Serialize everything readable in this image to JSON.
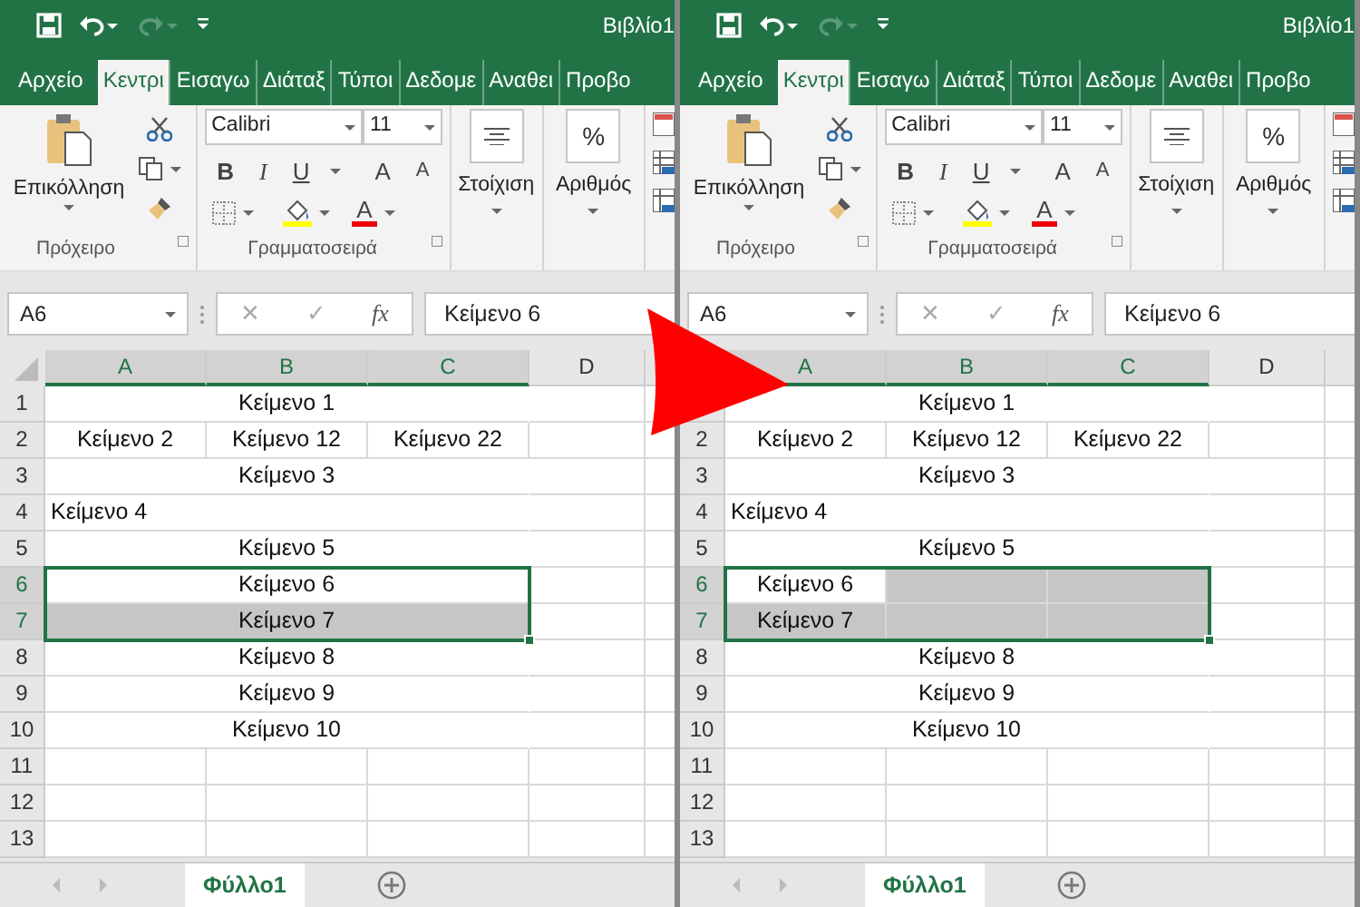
{
  "panes": [
    {
      "title": "Βιβλίο1",
      "select_all_corner": true,
      "tabs": [
        {
          "label": "Αρχείο",
          "selected": false
        },
        {
          "label": "Κεντρι",
          "selected": true
        },
        {
          "label": "Εισαγω",
          "selected": false
        },
        {
          "label": "Διάταξ",
          "selected": false
        },
        {
          "label": "Τύποι",
          "selected": false
        },
        {
          "label": "Δεδομε",
          "selected": false
        },
        {
          "label": "Αναθει",
          "selected": false
        },
        {
          "label": "Προβο",
          "selected": false
        }
      ],
      "ribbon": {
        "paste": "Επικόλληση",
        "clipboard_group": "Πρόχειρο",
        "font": "Calibri",
        "size": "11",
        "bold": "B",
        "italic": "I",
        "underline": "U",
        "grow": "A",
        "shrink": "A",
        "font_color": "A",
        "font_group": "Γραμματοσειρά",
        "alignment": "Στοίχιση",
        "number_symbol": "%",
        "number": "Αριθμός"
      },
      "formula_bar": {
        "name_box": "A6",
        "cancel": "✕",
        "enter": "✓",
        "function": "fx",
        "value": "Κείμενο 6"
      },
      "columns": [
        {
          "label": "A",
          "selected": true
        },
        {
          "label": "B",
          "selected": true
        },
        {
          "label": "C",
          "selected": true
        },
        {
          "label": "D",
          "selected": false
        }
      ],
      "rows": [
        {
          "num": "1",
          "selected": false,
          "kind": "merged",
          "cells": [
            {
              "text": "Κείμενο 1",
              "centered": true
            }
          ]
        },
        {
          "num": "2",
          "selected": false,
          "kind": "cells",
          "cells": [
            {
              "text": "Κείμενο 2",
              "centered": true
            },
            {
              "text": "Κείμενο 12",
              "centered": true
            },
            {
              "text": "Κείμενο 22",
              "centered": true
            }
          ]
        },
        {
          "num": "3",
          "selected": false,
          "kind": "merged",
          "cells": [
            {
              "text": "Κείμενο 3",
              "centered": true
            }
          ]
        },
        {
          "num": "4",
          "selected": false,
          "kind": "merged",
          "cells": [
            {
              "text": "Κείμενο 4",
              "centered": false
            }
          ]
        },
        {
          "num": "5",
          "selected": false,
          "kind": "merged",
          "cells": [
            {
              "text": "Κείμενο 5",
              "centered": true
            }
          ]
        },
        {
          "num": "6",
          "selected": true,
          "kind": "merged",
          "cells": [
            {
              "text": "Κείμενο 6",
              "centered": true,
              "selected": true,
              "active": true
            }
          ]
        },
        {
          "num": "7",
          "selected": true,
          "kind": "merged",
          "cells": [
            {
              "text": "Κείμενο 7",
              "centered": true,
              "selected": true,
              "active": false
            }
          ]
        },
        {
          "num": "8",
          "selected": false,
          "kind": "merged",
          "cells": [
            {
              "text": "Κείμενο 8",
              "centered": true
            }
          ]
        },
        {
          "num": "9",
          "selected": false,
          "kind": "merged",
          "cells": [
            {
              "text": "Κείμενο 9",
              "centered": true
            }
          ]
        },
        {
          "num": "10",
          "selected": false,
          "kind": "merged",
          "cells": [
            {
              "text": "Κείμενο 10",
              "centered": true
            }
          ]
        },
        {
          "num": "11",
          "selected": false,
          "kind": "cells",
          "cells": []
        },
        {
          "num": "12",
          "selected": false,
          "kind": "cells",
          "cells": []
        },
        {
          "num": "13",
          "selected": false,
          "kind": "cells",
          "cells": []
        }
      ],
      "sheets": [
        {
          "label": "Φύλλο1",
          "selected": true
        }
      ]
    },
    {
      "title": "Βιβλίο1",
      "tabs": [
        {
          "label": "Αρχείο",
          "selected": false
        },
        {
          "label": "Κεντρι",
          "selected": true
        },
        {
          "label": "Εισαγω",
          "selected": false
        },
        {
          "label": "Διάταξ",
          "selected": false
        },
        {
          "label": "Τύποι",
          "selected": false
        },
        {
          "label": "Δεδομε",
          "selected": false
        },
        {
          "label": "Αναθει",
          "selected": false
        },
        {
          "label": "Προβο",
          "selected": false
        }
      ],
      "ribbon": {
        "paste": "Επικόλληση",
        "clipboard_group": "Πρόχειρο",
        "font": "Calibri",
        "size": "11",
        "bold": "B",
        "italic": "I",
        "underline": "U",
        "grow": "A",
        "shrink": "A",
        "font_color": "A",
        "font_group": "Γραμματοσειρά",
        "alignment": "Στοίχιση",
        "number_symbol": "%",
        "number": "Αριθμός"
      },
      "formula_bar": {
        "name_box": "A6",
        "cancel": "✕",
        "enter": "✓",
        "function": "fx",
        "value": "Κείμενο 6"
      },
      "columns": [
        {
          "label": "A",
          "selected": true
        },
        {
          "label": "B",
          "selected": true
        },
        {
          "label": "C",
          "selected": true
        },
        {
          "label": "D",
          "selected": false
        }
      ],
      "rows": [
        {
          "kind": "merged",
          "cells": [
            {
              "text": "Κείμενο 1",
              "centered": true
            }
          ]
        },
        {
          "num": "2",
          "selected": false,
          "kind": "cells",
          "cells": [
            {
              "text": "Κείμενο 2",
              "centered": true
            },
            {
              "text": "Κείμενο 12",
              "centered": true
            },
            {
              "text": "Κείμενο 22",
              "centered": true
            }
          ]
        },
        {
          "num": "3",
          "selected": false,
          "kind": "merged",
          "cells": [
            {
              "text": "Κείμενο 3",
              "centered": true
            }
          ]
        },
        {
          "num": "4",
          "selected": false,
          "kind": "merged",
          "cells": [
            {
              "text": "Κείμενο 4",
              "centered": false
            }
          ]
        },
        {
          "num": "5",
          "selected": false,
          "kind": "merged",
          "cells": [
            {
              "text": "Κείμενο 5",
              "centered": true
            }
          ]
        },
        {
          "num": "6",
          "selected": true,
          "kind": "cells",
          "cells": [
            {
              "text": "Κείμενο 6",
              "centered": true,
              "selected": true,
              "active": true
            },
            {
              "selected": true,
              "active": false
            },
            {
              "selected": true,
              "active": false
            }
          ]
        },
        {
          "num": "7",
          "selected": true,
          "kind": "cells",
          "cells": [
            {
              "text": "Κείμενο 7",
              "centered": true,
              "selected": true,
              "active": false
            },
            {
              "selected": true,
              "active": false
            },
            {
              "selected": true,
              "active": false
            }
          ]
        },
        {
          "num": "8",
          "selected": false,
          "kind": "merged",
          "cells": [
            {
              "text": "Κείμενο 8",
              "centered": true
            }
          ]
        },
        {
          "num": "9",
          "selected": false,
          "kind": "merged",
          "cells": [
            {
              "text": "Κείμενο 9",
              "centered": true
            }
          ]
        },
        {
          "num": "10",
          "selected": false,
          "kind": "merged",
          "cells": [
            {
              "text": "Κείμενο 10",
              "centered": true
            }
          ]
        },
        {
          "num": "11",
          "selected": false,
          "kind": "cells",
          "cells": []
        },
        {
          "num": "12",
          "selected": false,
          "kind": "cells",
          "cells": []
        },
        {
          "num": "13",
          "selected": false,
          "kind": "cells",
          "cells": []
        }
      ],
      "sheets": [
        {
          "label": "Φύλλο1",
          "selected": true
        }
      ]
    }
  ]
}
